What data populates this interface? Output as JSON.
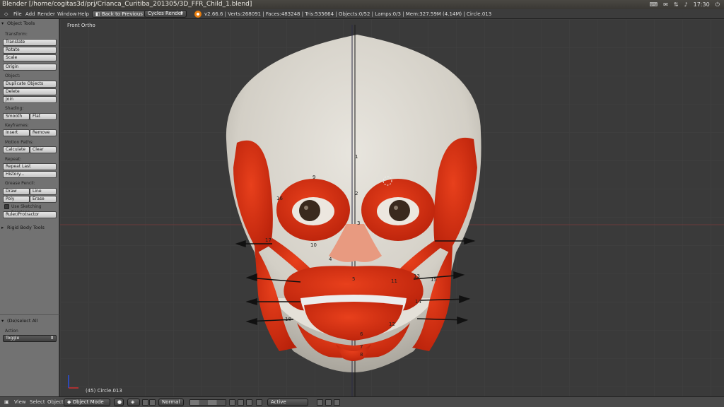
{
  "window": {
    "title": "Blender [/home/cogitas3d/prj/Crianca_Curitiba_201305/3D_FFR_Child_1.blend]",
    "clock": "17:30"
  },
  "infobar": {
    "menus": [
      "File",
      "Add",
      "Render",
      "Window",
      "Help"
    ],
    "back_button": "Back to Previous",
    "render_engine": "Cycles Render",
    "stats": "v2.66.6 | Verts:268091 | Faces:483248 | Tris:535664 | Objects:0/52 | Lamps:0/3 | Mem:327.59M (4.14M) | Circle.013"
  },
  "toolshelf": {
    "header": "Object Tools",
    "transform_label": "Transform:",
    "translate": "Translate",
    "rotate": "Rotate",
    "scale": "Scale",
    "origin": "Origin",
    "object_label": "Object:",
    "duplicate": "Duplicate Objects",
    "delete": "Delete",
    "join": "Join",
    "shading_label": "Shading:",
    "smooth": "Smooth",
    "flat": "Flat",
    "keyframes_label": "Keyframes:",
    "insert": "Insert",
    "remove": "Remove",
    "motion_label": "Motion Paths:",
    "calculate": "Calculate",
    "clear": "Clear",
    "repeat_label": "Repeat:",
    "repeat_last": "Repeat Last",
    "history": "History...",
    "grease_label": "Grease Pencil:",
    "draw": "Draw",
    "line": "Line",
    "poly": "Poly",
    "erase": "Erase",
    "sketching": "Use Sketching Sessions",
    "ruler": "Ruler/Protractor",
    "rigid_body": "Rigid Body Tools",
    "deselect_header": "(De)select All",
    "action_label": "Action",
    "action_value": "Toggle"
  },
  "viewport": {
    "view_name": "Front Ortho",
    "selected_object": "(45) Circle.013",
    "muscle_labels": [
      {
        "id": "1",
        "text": "1"
      },
      {
        "id": "2",
        "text": "2"
      },
      {
        "id": "3",
        "text": "3"
      },
      {
        "id": "4",
        "text": "4"
      },
      {
        "id": "5",
        "text": "5"
      },
      {
        "id": "6",
        "text": "6"
      },
      {
        "id": "7",
        "text": "7"
      },
      {
        "id": "8",
        "text": "8"
      },
      {
        "id": "9",
        "text": "9"
      },
      {
        "id": "10",
        "text": "10"
      },
      {
        "id": "11",
        "text": "11"
      },
      {
        "id": "12",
        "text": "12"
      },
      {
        "id": "13",
        "text": "13"
      },
      {
        "id": "14",
        "text": "14"
      },
      {
        "id": "15",
        "text": "15"
      },
      {
        "id": "16",
        "text": "16"
      },
      {
        "id": "17",
        "text": "17"
      },
      {
        "id": "18",
        "text": "18"
      }
    ]
  },
  "bottombar": {
    "view": "View",
    "select": "Select",
    "object": "Object",
    "mode": "Object Mode",
    "pivot": "Normal",
    "snap": "Active"
  },
  "colors": {
    "muscle": "#d42a0c",
    "skull": "#dcd8d0",
    "viewport_bg": "#3a3a3a",
    "shelf_bg": "#727272"
  }
}
